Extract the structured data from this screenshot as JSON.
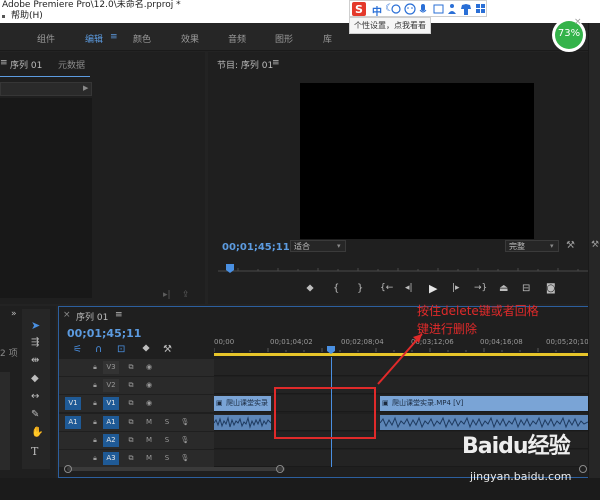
{
  "window": {
    "title": "Adobe Premiere Pro\\12.0\\未命名.prproj *",
    "menu_item": "帮助(H)"
  },
  "workspace_tabs": [
    {
      "label": "组件",
      "active": false
    },
    {
      "label": "编辑",
      "active": true
    },
    {
      "label": "颜色",
      "active": false
    },
    {
      "label": "效果",
      "active": false
    },
    {
      "label": "音频",
      "active": false
    },
    {
      "label": "图形",
      "active": false
    },
    {
      "label": "库",
      "active": false
    }
  ],
  "ime": {
    "tip": "个性设置，点我看看",
    "battery": "73%",
    "zh": "中"
  },
  "source_panel": {
    "tab1": "序列 01",
    "tab2": "元数据"
  },
  "program_monitor": {
    "title": "节目: 序列 01",
    "timecode": "00;01;45;11",
    "fit": "适合",
    "quality": "完整"
  },
  "timeline": {
    "tab": "序列 01",
    "timecode": "00;01;45;11",
    "ruler": [
      "00;00",
      "00;01;04;02",
      "00;02;08;04",
      "00;03;12;06",
      "00;04;16;08",
      "00;05;20;10"
    ],
    "video_tracks": [
      {
        "name": "V3",
        "patch": ""
      },
      {
        "name": "V2",
        "patch": ""
      },
      {
        "name": "V1",
        "patch": "V1"
      }
    ],
    "audio_tracks": [
      {
        "name": "A1",
        "patch": "A1"
      },
      {
        "name": "A2",
        "patch": ""
      },
      {
        "name": "A3",
        "patch": ""
      }
    ],
    "mute": "M",
    "solo": "S",
    "clip_left": "爬山课堂实录",
    "clip_right": "爬山课堂实录.MP4 [V]"
  },
  "annotation": {
    "line1": "按住delete键或者回格",
    "line2": "键进行删除"
  },
  "watermark": {
    "brand": "Baidu经验",
    "url": "jingyan.baidu.com"
  },
  "colors": {
    "accent_blue": "#5c9be0",
    "annotation_red": "#e02a2a",
    "playhead_blue": "#4a90e2"
  }
}
